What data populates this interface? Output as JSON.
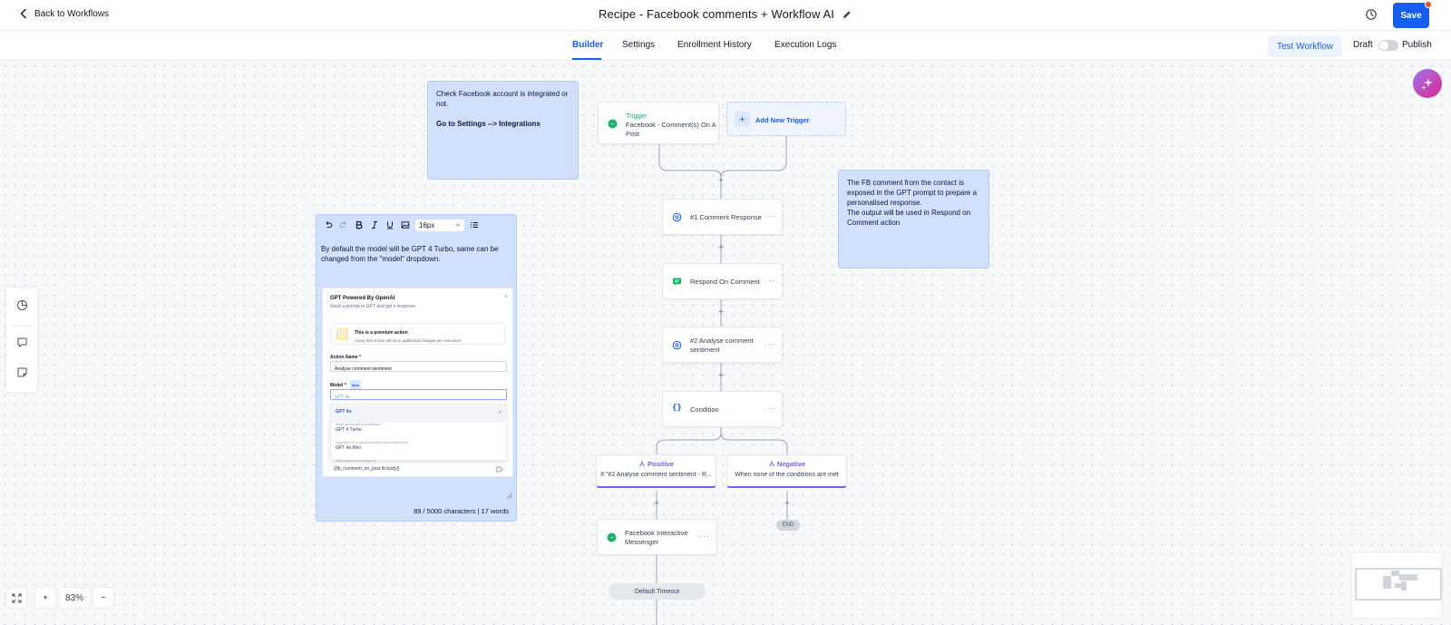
{
  "header": {
    "back_label": "Back to Workflows",
    "title": "Recipe - Facebook comments + Workflow AI",
    "save_label": "Save"
  },
  "tabs": [
    {
      "label": "Builder",
      "active": true
    },
    {
      "label": "Settings",
      "active": false
    },
    {
      "label": "Enrollment History",
      "active": false
    },
    {
      "label": "Execution Logs",
      "active": false
    }
  ],
  "actions": {
    "test_label": "Test Workflow",
    "draft_label": "Draft",
    "publish_label": "Publish",
    "published": false
  },
  "notes": {
    "integration": {
      "line1": "Check Facebook account is integrated or not.",
      "line2": "Go to Settings --> Integrations"
    },
    "fb_comment": {
      "line1": "The FB comment from the contact is exposed in the GPT prompt to prepare a personalised response.",
      "line2": "The output will be used in Respond on Comment action"
    },
    "model": {
      "font_size": "16px",
      "text": "By default the model will be GPT 4 Turbo, same can be changed from the \"model\" dropdown.",
      "char_count": "89 / 5000 characters | 17 words"
    }
  },
  "gpt_panel": {
    "title": "GPT Powered By OpenAI",
    "subtitle": "Send a prompt to GPT and get a response",
    "premium_title": "This is a premium action",
    "premium_desc": "Using this action will incur additional charges per execution",
    "action_name_label": "Action Name *",
    "action_name_value": "Analyse comment sentiment",
    "model_label": "Model *",
    "new_badge": "New",
    "model_placeholder": "GPT 4o",
    "options": [
      {
        "name": "GPT 4o",
        "desc": "Most advanced and efficient",
        "selected": true
      },
      {
        "name": "GPT 4 Turbo",
        "desc": "Upgrade for a transformative chat experience",
        "selected": false
      },
      {
        "name": "GPT 4o Mini",
        "desc": "Affordable and intelligent",
        "selected": false
      }
    ],
    "variable": "{{fb_comment_on_post.fb.body}}"
  },
  "workflow": {
    "trigger_tag": "Trigger",
    "trigger_label": "Facebook - Comment(s) On A Post",
    "add_trigger_label": "Add New Trigger",
    "steps": [
      {
        "label": "#1 Comment Response"
      },
      {
        "label": "Respond On Comment"
      },
      {
        "label": "#2 Analyse comment sentiment"
      },
      {
        "label": "Condition"
      }
    ],
    "branches": [
      {
        "name": "Positive",
        "desc": "If \"#2 Analyse comment sentiment - R..."
      },
      {
        "name": "Negative",
        "desc": "When none of the conditions are met"
      }
    ],
    "messenger_label": "Facebook Interactive Messenger",
    "end_label": "END",
    "timeout_label": "Default Timeout",
    "more_glyph": "···",
    "plus_glyph": "+"
  },
  "zoom": {
    "level": "83%",
    "plus": "+",
    "minus": "−"
  },
  "colors": {
    "accent": "#155eef",
    "note_bg": "#d1e0ff",
    "branch": "#7a5af8",
    "trigger": "#17b26a",
    "messenger": "#17b26a"
  }
}
